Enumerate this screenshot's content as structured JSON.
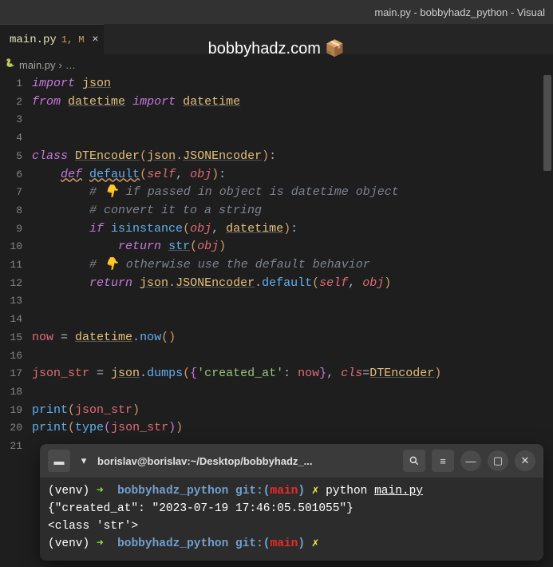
{
  "window_title": "main.py - bobbyhadz_python - Visual",
  "watermark": "bobbyhadz.com 📦",
  "tab": {
    "filename": "main.py",
    "modified": "1, M",
    "close": "×"
  },
  "breadcrumb": {
    "file": "main.py",
    "sep": "›",
    "more": "…"
  },
  "lines": [
    "1",
    "2",
    "3",
    "4",
    "5",
    "6",
    "7",
    "8",
    "9",
    "10",
    "11",
    "12",
    "13",
    "14",
    "15",
    "16",
    "17",
    "18",
    "19",
    "20",
    "21"
  ],
  "code": {
    "l1": {
      "import": "import",
      "json": "json"
    },
    "l2": {
      "from": "from",
      "datetime1": "datetime",
      "import": "import",
      "datetime2": "datetime"
    },
    "l5": {
      "class": "class",
      "name": "DTEncoder",
      "lp": "(",
      "json": "json",
      "dot": ".",
      "enc": "JSONEncoder",
      "rp": ")",
      "colon": ":"
    },
    "l6": {
      "def": "def",
      "name": "default",
      "lp": "(",
      "self": "self",
      "comma": ", ",
      "obj": "obj",
      "rp": ")",
      "colon": ":"
    },
    "l7": {
      "text": "# 👇 if passed in object is datetime object"
    },
    "l8": {
      "text": "# convert it to a string"
    },
    "l9": {
      "if": "if",
      "isinstance": "isinstance",
      "lp": "(",
      "obj": "obj",
      "comma": ", ",
      "datetime": "datetime",
      "rp": ")",
      "colon": ":"
    },
    "l10": {
      "return": "return",
      "str": "str",
      "lp": "(",
      "obj": "obj",
      "rp": ")"
    },
    "l11": {
      "text": "# 👇 otherwise use the default behavior"
    },
    "l12": {
      "return": "return",
      "json": "json",
      "dot1": ".",
      "enc": "JSONEncoder",
      "dot2": ".",
      "default": "default",
      "lp": "(",
      "self": "self",
      "comma": ", ",
      "obj": "obj",
      "rp": ")"
    },
    "l15": {
      "now": "now",
      "eq": " = ",
      "datetime": "datetime",
      "dot": ".",
      "nowfn": "now",
      "lp": "(",
      "rp": ")"
    },
    "l17": {
      "jsonstr": "json_str",
      "eq": " = ",
      "json": "json",
      "dot": ".",
      "dumps": "dumps",
      "lp": "(",
      "lb": "{",
      "key": "'created_at'",
      "colon": ": ",
      "now": "now",
      "rb": "}",
      "comma": ", ",
      "cls": "cls",
      "eq2": "=",
      "enc": "DTEncoder",
      "rp": ")"
    },
    "l19": {
      "print": "print",
      "lp": "(",
      "arg": "json_str",
      "rp": ")"
    },
    "l20": {
      "print": "print",
      "lp": "(",
      "type": "type",
      "lp2": "(",
      "arg": "json_str",
      "rp2": ")",
      "rp": ")"
    }
  },
  "terminal": {
    "title": "borislav@borislav:~/Desktop/bobbyhadz_...",
    "p1": {
      "venv": "(venv)",
      "arrow": " ➜  ",
      "dir": "bobbyhadz_python",
      "git": " git:(",
      "branch": "main",
      "gitend": ") ",
      "dirty": "✗",
      "cmd": " python ",
      "file": "main.py"
    },
    "out1": "{\"created_at\": \"2023-07-19 17:46:05.501055\"}",
    "out2": "<class 'str'>",
    "p2": {
      "venv": "(venv)",
      "arrow": " ➜  ",
      "dir": "bobbyhadz_python",
      "git": " git:(",
      "branch": "main",
      "gitend": ") ",
      "dirty": "✗"
    }
  }
}
